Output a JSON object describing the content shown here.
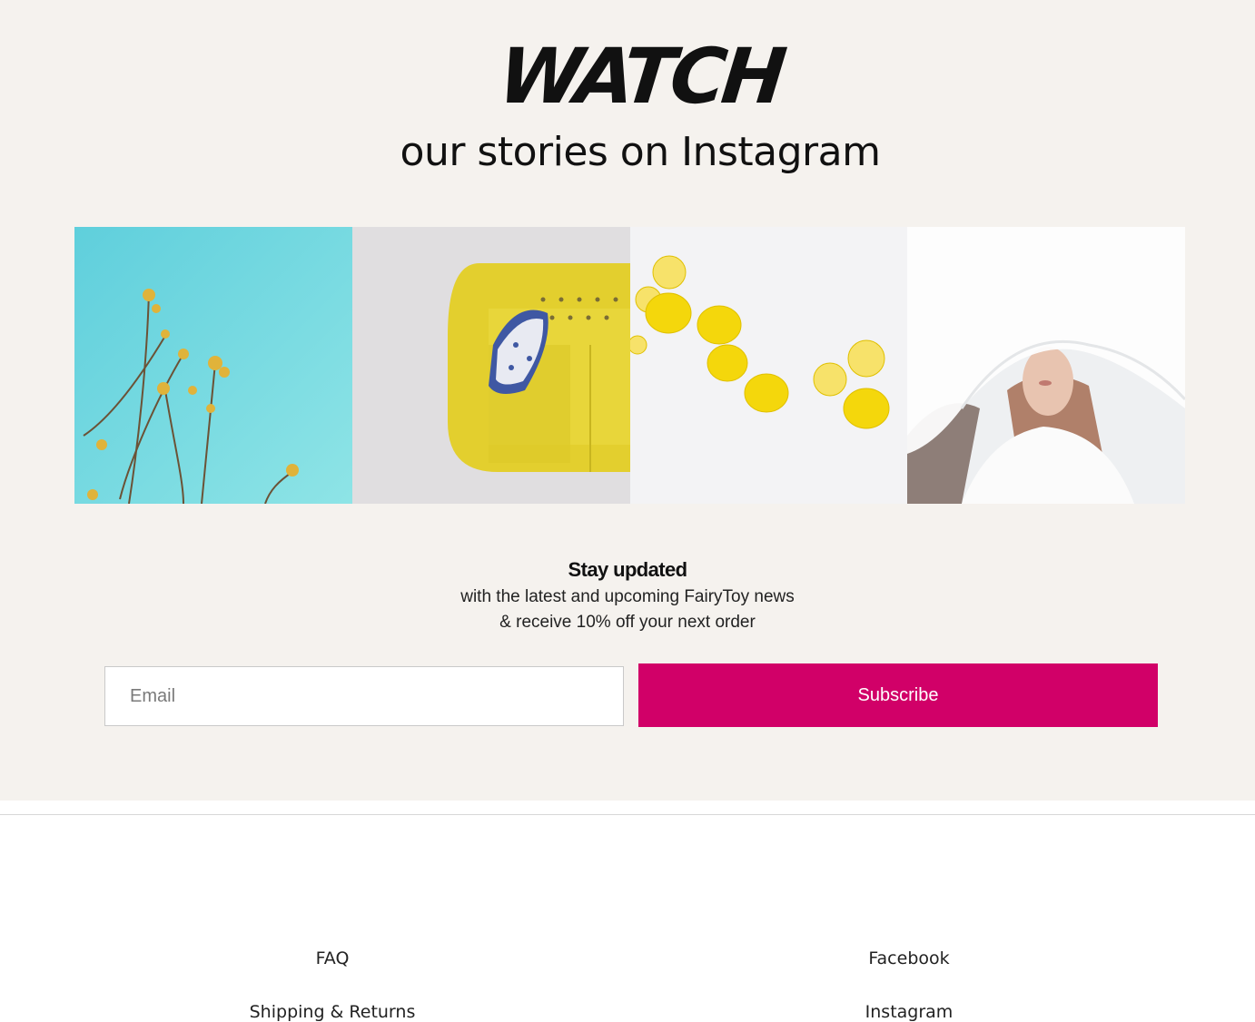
{
  "instagram_section": {
    "watch_title": "WATCH",
    "subtitle": "our stories on Instagram",
    "gallery": [
      {
        "label": "yellow-flowers-blue-sky"
      },
      {
        "label": "yellow-sofa"
      },
      {
        "label": "lemons"
      },
      {
        "label": "woman-white-veil"
      }
    ]
  },
  "newsletter": {
    "heading": "Stay updated",
    "line1": "with the latest and upcoming FairyToy news",
    "line2": "& receive 10% off your next order",
    "email_placeholder": "Email",
    "subscribe_label": "Subscribe"
  },
  "footer": {
    "left_links": [
      "FAQ",
      "Shipping & Returns"
    ],
    "right_links": [
      "Facebook",
      "Instagram"
    ]
  },
  "colors": {
    "section_bg": "#f5f2ee",
    "accent": "#d10068"
  }
}
